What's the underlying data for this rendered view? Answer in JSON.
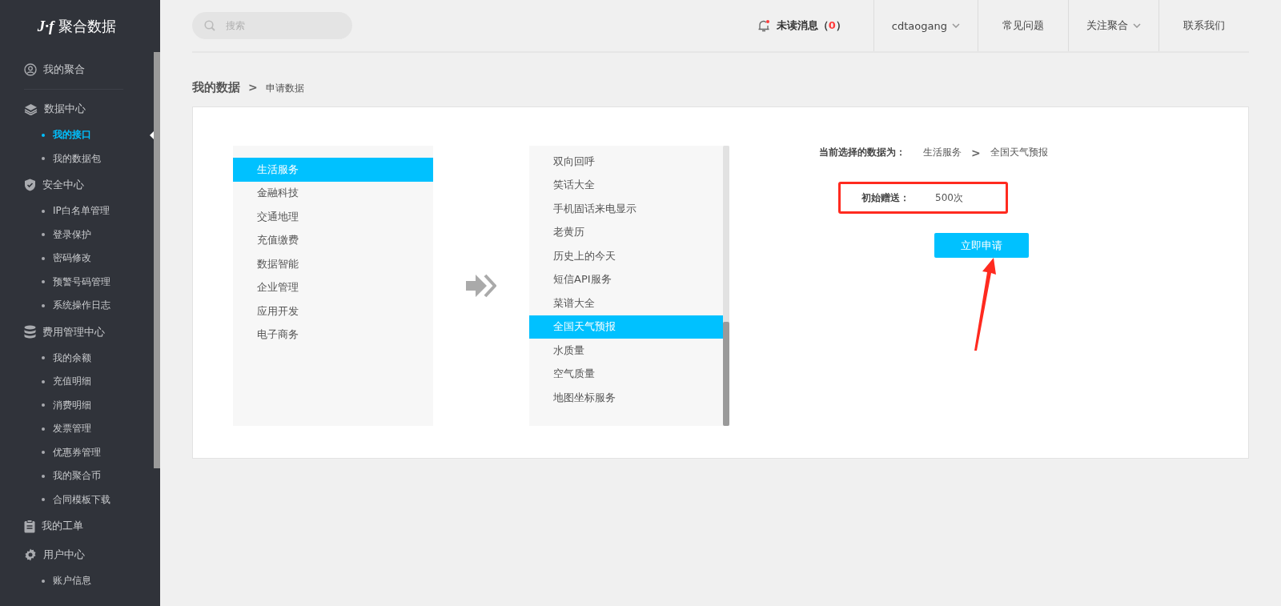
{
  "sidebar": {
    "logo": {
      "mark": "J·f",
      "name": "聚合数据"
    },
    "groups": [
      {
        "kind": "user",
        "label": "我的聚合"
      },
      {
        "kind": "layers",
        "label": "数据中心",
        "children": [
          {
            "label": "我的接口",
            "selected": true
          },
          {
            "label": "我的数据包",
            "selected": false
          }
        ]
      },
      {
        "kind": "shield",
        "label": "安全中心",
        "children": [
          {
            "label": "IP白名单管理",
            "selected": false
          },
          {
            "label": "登录保护",
            "selected": false
          },
          {
            "label": "密码修改",
            "selected": false
          },
          {
            "label": "预警号码管理",
            "selected": false
          },
          {
            "label": "系统操作日志",
            "selected": false
          }
        ]
      },
      {
        "kind": "database",
        "label": "费用管理中心",
        "children": [
          {
            "label": "我的余额",
            "selected": false
          },
          {
            "label": "充值明细",
            "selected": false
          },
          {
            "label": "消费明细",
            "selected": false
          },
          {
            "label": "发票管理",
            "selected": false
          },
          {
            "label": "优惠券管理",
            "selected": false
          },
          {
            "label": "我的聚合币",
            "selected": false
          },
          {
            "label": "合同模板下载",
            "selected": false
          }
        ]
      },
      {
        "kind": "clipboard",
        "label": "我的工单"
      },
      {
        "kind": "gear",
        "label": "用户中心",
        "children": [
          {
            "label": "账户信息",
            "selected": false
          }
        ]
      }
    ]
  },
  "header": {
    "search": {
      "placeholder": "搜索"
    },
    "messages": {
      "label": "未读消息（",
      "count": "0",
      "close": "）"
    },
    "nav": [
      {
        "label": "cdtaogang",
        "dropdown": true
      },
      {
        "label": "常见问题",
        "dropdown": false
      },
      {
        "label": "关注聚合",
        "dropdown": true
      },
      {
        "label": "联系我们",
        "dropdown": false
      }
    ]
  },
  "breadcrumb": {
    "title": "我的数据",
    "separator": ">",
    "current": "申请数据"
  },
  "categories": [
    {
      "label": "生活服务",
      "selected": true
    },
    {
      "label": "金融科技",
      "selected": false
    },
    {
      "label": "交通地理",
      "selected": false
    },
    {
      "label": "充值缴费",
      "selected": false
    },
    {
      "label": "数据智能",
      "selected": false
    },
    {
      "label": "企业管理",
      "selected": false
    },
    {
      "label": "应用开发",
      "selected": false
    },
    {
      "label": "电子商务",
      "selected": false
    }
  ],
  "apis": [
    {
      "label": "双向回呼",
      "selected": false
    },
    {
      "label": "笑话大全",
      "selected": false
    },
    {
      "label": "手机固话来电显示",
      "selected": false
    },
    {
      "label": "老黄历",
      "selected": false
    },
    {
      "label": "历史上的今天",
      "selected": false
    },
    {
      "label": "短信API服务",
      "selected": false
    },
    {
      "label": "菜谱大全",
      "selected": false
    },
    {
      "label": "全国天气预报",
      "selected": true
    },
    {
      "label": "水质量",
      "selected": false
    },
    {
      "label": "空气质量",
      "selected": false
    },
    {
      "label": "地图坐标服务",
      "selected": false
    }
  ],
  "selection": {
    "label": "当前选择的数据为：",
    "category": "生活服务",
    "separator": ">",
    "api": "全国天气预报"
  },
  "gift": {
    "label": "初始赠送：",
    "value": "500次",
    "highlighted": true
  },
  "apply_button": "立即申请",
  "annotation_arrow": true
}
